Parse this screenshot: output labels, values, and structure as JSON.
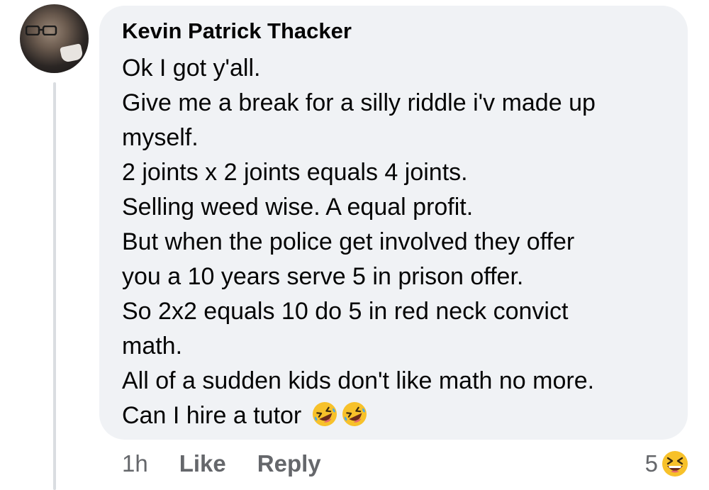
{
  "comment": {
    "author": "Kevin Patrick Thacker",
    "lines": [
      "Ok I got y'all.",
      "Give me a break for a silly riddle i'v made up",
      "myself.",
      "2 joints x 2 joints equals 4 joints.",
      "Selling weed wise.  A equal profit.",
      "But when the police get involved they offer",
      "you a 10 years serve 5 in prison offer.",
      "So 2x2 equals 10 do 5 in red neck convict",
      "math.",
      "All of a sudden kids don't like math no more.",
      "Can I hire a tutor"
    ],
    "trailing_emojis": [
      "rolling-on-floor-laughing",
      "rolling-on-floor-laughing"
    ]
  },
  "actions": {
    "time": "1h",
    "like_label": "Like",
    "reply_label": "Reply"
  },
  "reactions": {
    "count": "5",
    "emoji": "grinning-squinting-face"
  },
  "colors": {
    "bubble": "#f0f2f5",
    "text": "#050505",
    "secondary": "#65676b",
    "thread_line": "#dadde1"
  }
}
